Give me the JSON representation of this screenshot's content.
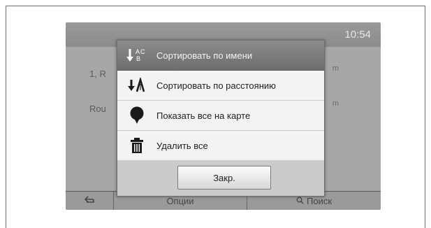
{
  "status": {
    "time": "10:54"
  },
  "background_list": [
    {
      "label": "1, R",
      "distance": "m"
    },
    {
      "label": "Rou",
      "distance": "m"
    }
  ],
  "bottom_bar": {
    "back_icon": "back-arrow-icon",
    "options_label": "Опции",
    "search_label": "Поиск",
    "search_icon": "magnifier-icon"
  },
  "menu": {
    "items": [
      {
        "icon": "sort-az-icon",
        "label": "Сортировать по имени",
        "selected": true
      },
      {
        "icon": "sort-distance-icon",
        "label": "Сортировать по расстоянию",
        "selected": false
      },
      {
        "icon": "map-pin-icon",
        "label": "Показать все на карте",
        "selected": false
      },
      {
        "icon": "trash-icon",
        "label": "Удалить все",
        "selected": false
      }
    ],
    "close_label": "Закр."
  },
  "colors": {
    "screen_bg": "#a7a7a7",
    "popup_bg": "#f3f3f3",
    "selected_bg": "#7d7d7d"
  }
}
